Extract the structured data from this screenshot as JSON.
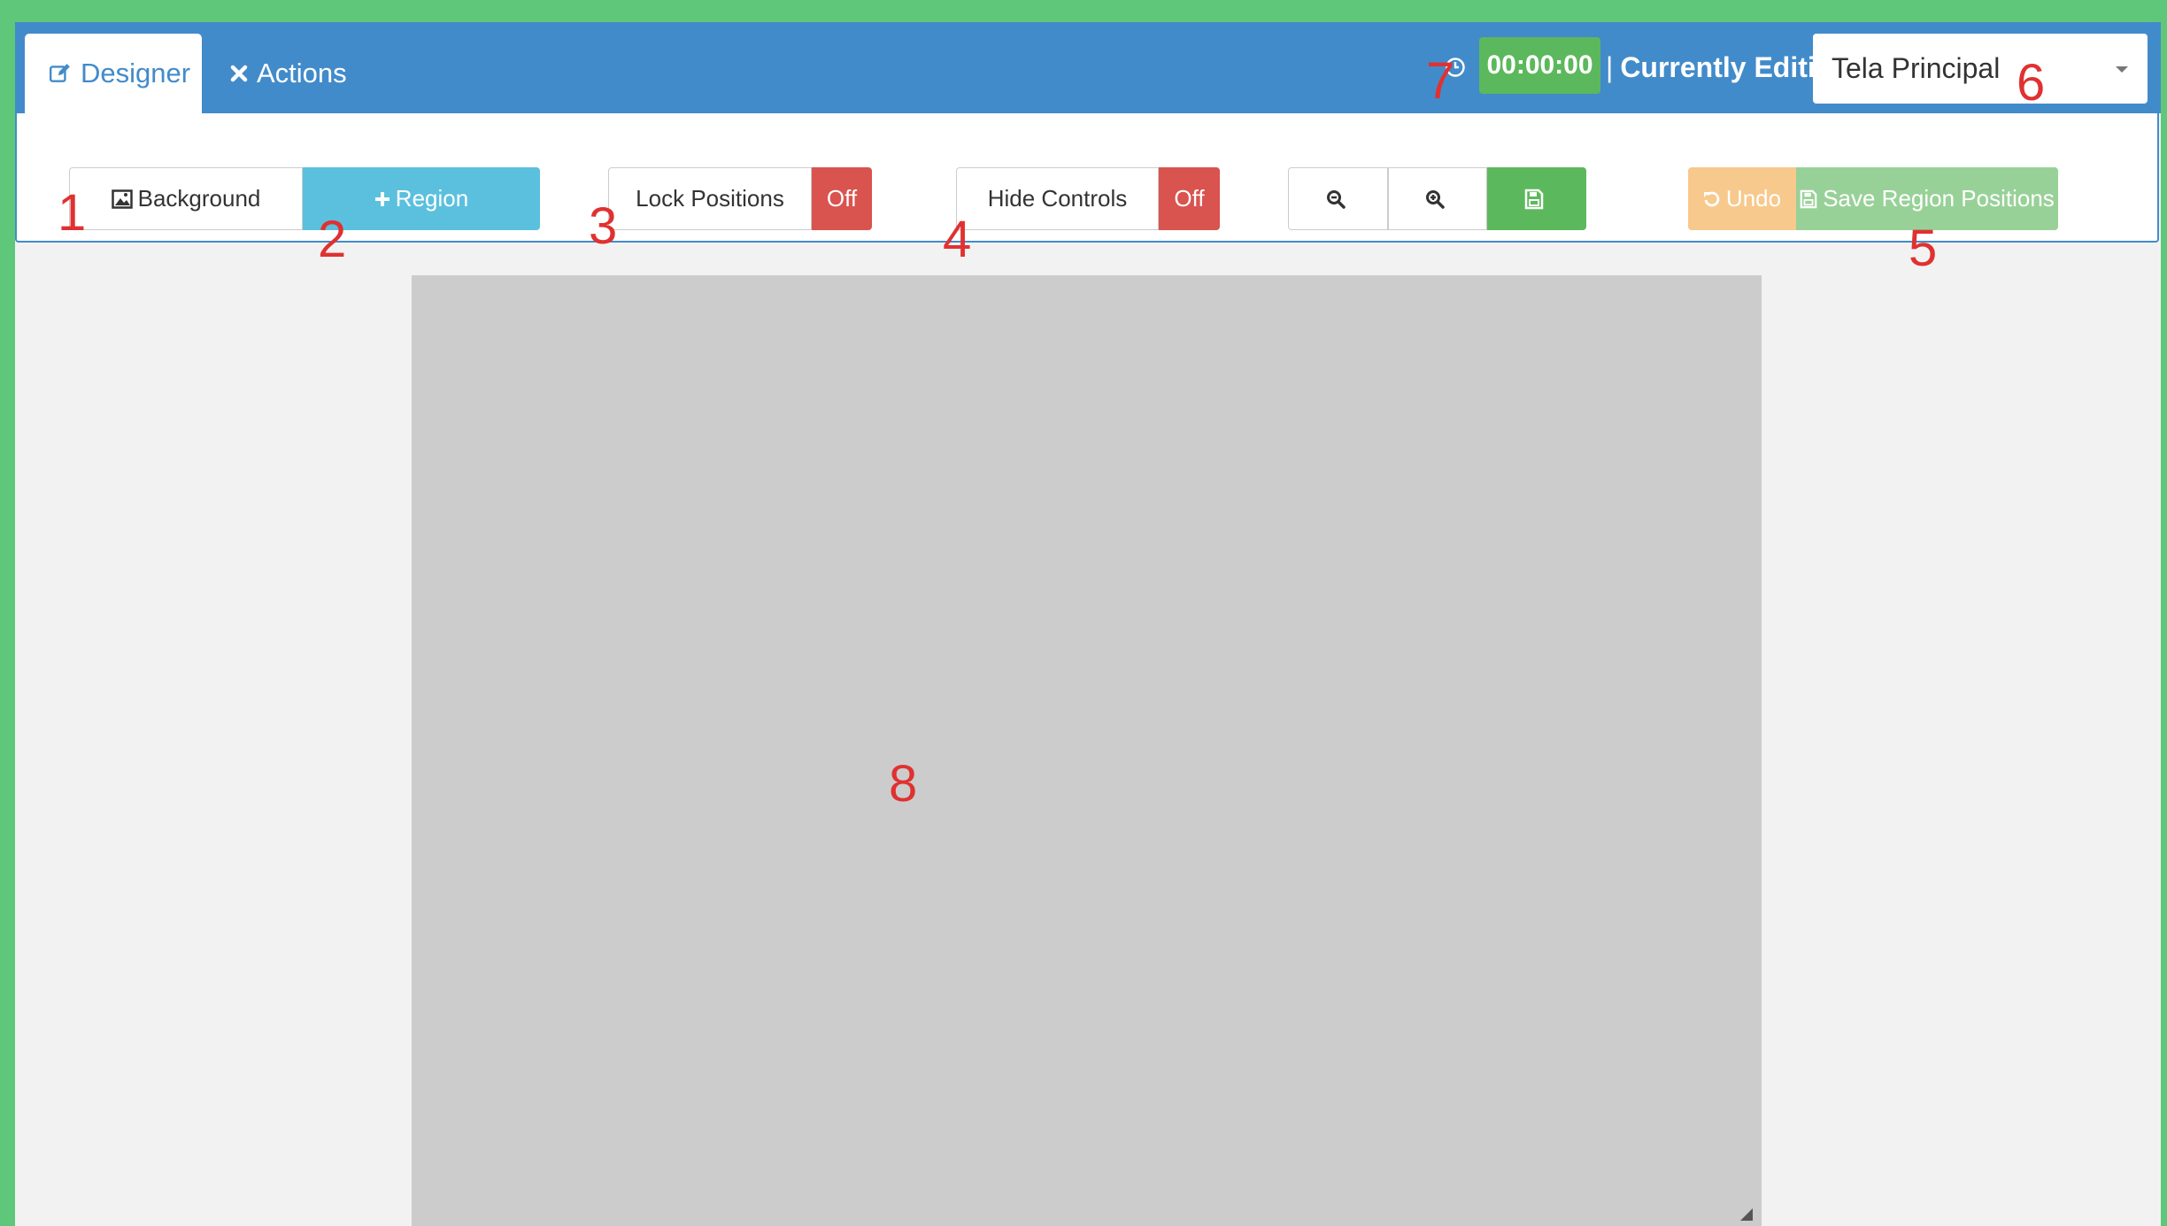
{
  "tabs": {
    "designer": "Designer",
    "actions": "Actions"
  },
  "header": {
    "timer": "00:00:00",
    "currently_editing_label": "Currently Editing",
    "separator": "|",
    "selected_screen": "Tela Principal"
  },
  "toolbar": {
    "background_label": "Background",
    "region_label": "Region",
    "lock_positions_label": "Lock Positions",
    "lock_positions_state": "Off",
    "hide_controls_label": "Hide Controls",
    "hide_controls_state": "Off",
    "undo_label": "Undo",
    "save_region_positions_label": "Save Region Positions"
  },
  "annotations": {
    "n1": "1",
    "n2": "2",
    "n3": "3",
    "n4": "4",
    "n5": "5",
    "n6": "6",
    "n7": "7",
    "n8": "8"
  },
  "colors": {
    "primary": "#428bca",
    "info": "#5bc0de",
    "danger": "#d9534f",
    "success": "#5cb85c",
    "frame": "#5fc779",
    "annotation": "#e03131"
  },
  "icons": [
    "pencil-square-icon",
    "close-icon",
    "clock-icon",
    "caret-down-icon",
    "image-icon",
    "plus-icon",
    "zoom-out-icon",
    "zoom-in-icon",
    "save-icon",
    "undo-icon",
    "resize-handle-icon"
  ]
}
